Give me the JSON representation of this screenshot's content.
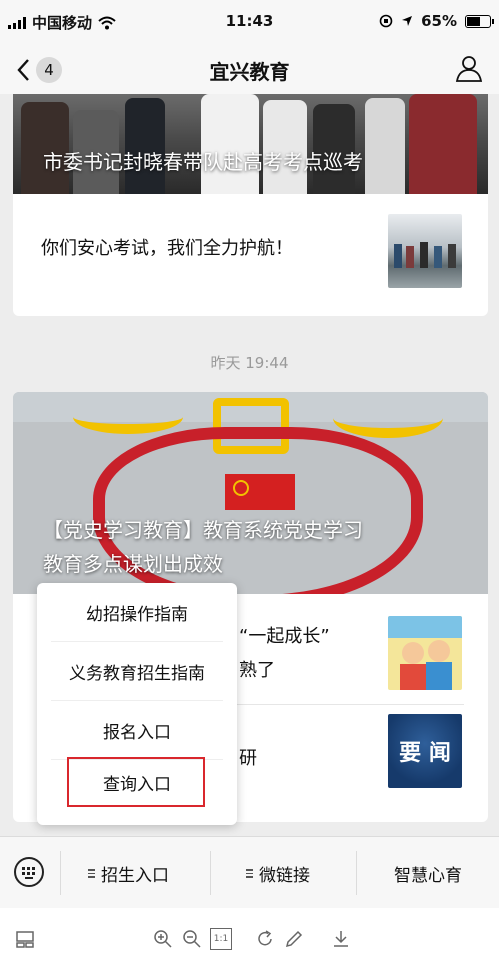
{
  "status_bar": {
    "carrier": "中国移动",
    "time": "11:43",
    "battery": "65%"
  },
  "nav": {
    "back_count": "4",
    "title": "宜兴教育"
  },
  "article1": {
    "image_caption": "市委书记封晓春带队赴高考考点巡考",
    "subtitle": "你们安心考试，我们全力护航！"
  },
  "timestamp": "昨天 19:44",
  "article2": {
    "image_caption_line1": "【党史学习教育】教育系统党史学习",
    "image_caption_line2": "教育多点谋划出成效",
    "item2_text_line1": "“一起成长”",
    "item2_text_line2": "熟了",
    "item3_text": "研",
    "item3_thumb_text": "要 闻"
  },
  "popup": {
    "items": [
      "幼招操作指南",
      "义务教育招生指南",
      "报名入口",
      "查询入口"
    ],
    "highlighted_index": 3,
    "highlight_color": "#d9272d"
  },
  "menu": {
    "items": [
      "招生入口",
      "微链接",
      "智慧心育"
    ]
  },
  "toolbar": {
    "icons": [
      "layout-icon",
      "zoom-in-icon",
      "zoom-out-icon",
      "actual-size-icon",
      "rotate-icon",
      "edit-icon",
      "download-icon"
    ],
    "actual_size_label": "1:1"
  }
}
